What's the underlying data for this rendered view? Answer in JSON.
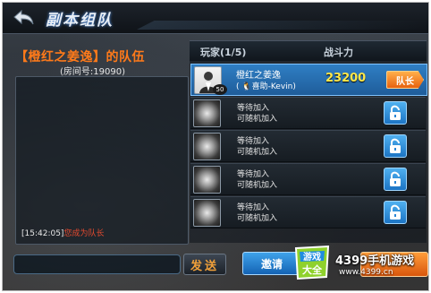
{
  "header": {
    "title": "副本组队"
  },
  "team": {
    "name": "【橙红之姜逸】的队伍",
    "room_no": "(房间号:19090)"
  },
  "chat": {
    "time": "[15:42:05]",
    "system_msg": "您成为队长"
  },
  "list": {
    "col_player": "玩家(1/5)",
    "col_power": "战斗力"
  },
  "leader": {
    "name": "橙红之姜逸",
    "sub": "( 🐧喜助-Kevin)",
    "level": "50",
    "power": "23200",
    "tag": "队长"
  },
  "waiting": [
    {
      "main": "等待加入",
      "sub": "可随机加入"
    },
    {
      "main": "等待加入",
      "sub": "可随机加入"
    },
    {
      "main": "等待加入",
      "sub": "可随机加入"
    },
    {
      "main": "等待加入",
      "sub": "可随机加入"
    }
  ],
  "buttons": {
    "send": "发送",
    "invite": "邀请"
  },
  "watermark": {
    "brand": "4399手机游戏",
    "url": "www.4399.cn"
  },
  "colors": {
    "accent_orange": "#ff7a1a",
    "accent_blue": "#2f7fc4",
    "power_yellow": "#ffe84a"
  }
}
